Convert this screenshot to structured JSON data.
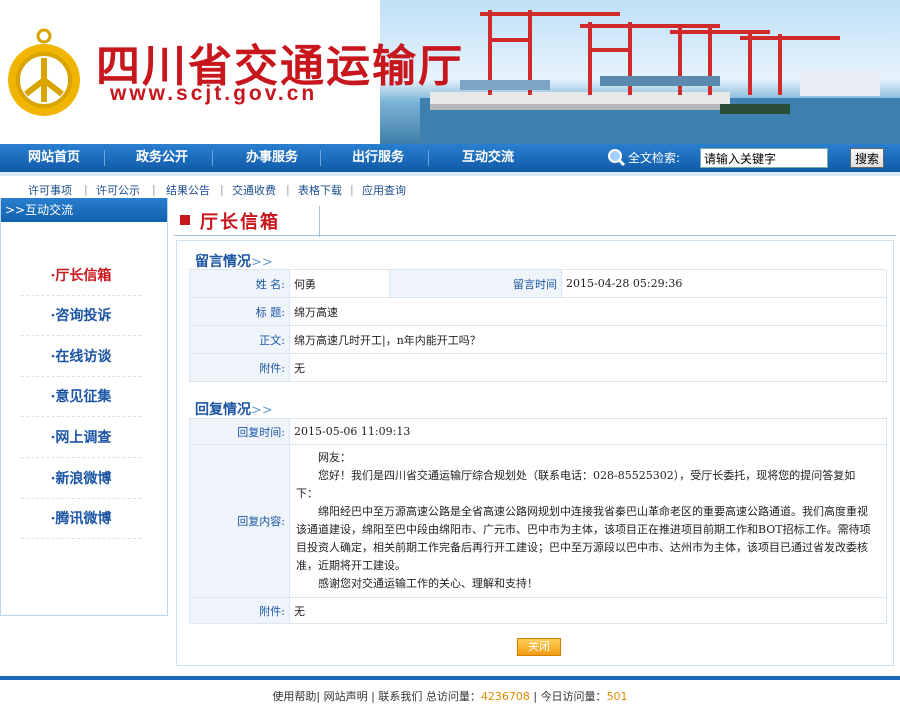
{
  "header": {
    "site_title": "四川省交通运输厅",
    "site_url": "www.scjt.gov.cn"
  },
  "nav": {
    "items": [
      "网站首页",
      "政务公开",
      "办事服务",
      "出行服务",
      "互动交流"
    ],
    "search_label": "全文检索:",
    "search_value": "请输入关键字",
    "search_button": "搜索"
  },
  "subnav": {
    "items": [
      "许可事项",
      "许可公示",
      "结果公告",
      "交通收费",
      "表格下载",
      "应用查询"
    ]
  },
  "sidebar": {
    "heading": ">>互动交流",
    "items": [
      "·厅长信箱",
      "·咨询投诉",
      "·在线访谈",
      "·意见征集",
      "·网上调查",
      "·新浪微博",
      "·腾讯微博"
    ]
  },
  "page": {
    "title": "厅长信箱"
  },
  "message": {
    "section_title": "留言情况",
    "arrows": ">>",
    "name_label": "姓 名:",
    "name_value": "何勇",
    "time_label": "留言时间",
    "time_value": "2015-04-28 05:29:36",
    "subject_label": "标 题:",
    "subject_value": "绵万高速",
    "body_label": "正文:",
    "body_value": "绵万高速几时开工|，n年内能开工吗？",
    "attach_label": "附件:",
    "attach_value": "无"
  },
  "reply": {
    "section_title": "回复情况",
    "arrows": ">>",
    "time_label": "回复时间:",
    "time_value": "2015-05-06 11:09:13",
    "content_label": "回复内容:",
    "paragraphs": [
      "网友：",
      "您好！我们是四川省交通运输厅综合规划处（联系电话：028-85525302），受厅长委托，现将您的提问答复如下：",
      "绵阳经巴中至万源高速公路是全省高速公路网规划中连接我省秦巴山革命老区的重要高速公路通道。我们高度重视该通道建设，绵阳至巴中段由绵阳市、广元市、巴中市为主体，该项目正在推进项目前期工作和BOT招标工作。需待项目投资人确定，相关前期工作完备后再行开工建设；巴中至万源段以巴中市、达州市为主体，该项目已通过省发改委核准，近期将开工建设。",
      "感谢您对交通运输工作的关心、理解和支持！"
    ],
    "attach_label": "附件:",
    "attach_value": "无",
    "close_button": "关闭"
  },
  "footer": {
    "help": "使用帮助",
    "statement": "网站声明",
    "contact": "联系我们",
    "total_label": "总访问量：",
    "total_value": "4236708",
    "today_label": "今日访问量：",
    "today_value": "501"
  },
  "colors": {
    "brand_red": "#c8161d",
    "nav_blue": "#1160ad",
    "link_blue": "#1b55a3"
  }
}
